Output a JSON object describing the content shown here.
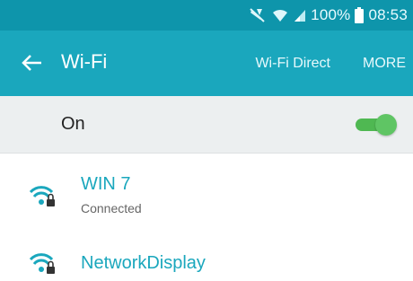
{
  "status_bar": {
    "battery_text": "100%",
    "time": "08:53",
    "icons": [
      "mute-icon",
      "wifi-signal-icon",
      "cell-signal-icon",
      "battery-icon"
    ]
  },
  "app_bar": {
    "title": "Wi-Fi",
    "back_icon": "arrow-left-icon",
    "actions": {
      "wifi_direct": "Wi-Fi Direct",
      "more": "MORE"
    }
  },
  "toggle": {
    "label": "On",
    "checked": true
  },
  "networks": [
    {
      "name": "WIN 7",
      "status": "Connected",
      "icon": "wifi-lock-icon"
    },
    {
      "name": "NetworkDisplay",
      "status": "",
      "icon": "wifi-lock-icon"
    }
  ],
  "colors": {
    "status_bar": "#0e95ab",
    "app_bar": "#1aa7bd",
    "toggle_row_bg": "#eceff0",
    "switch_on": "#4fb852",
    "network_name": "#1aa7bd",
    "wifi_icon": "#1aa7bd"
  }
}
